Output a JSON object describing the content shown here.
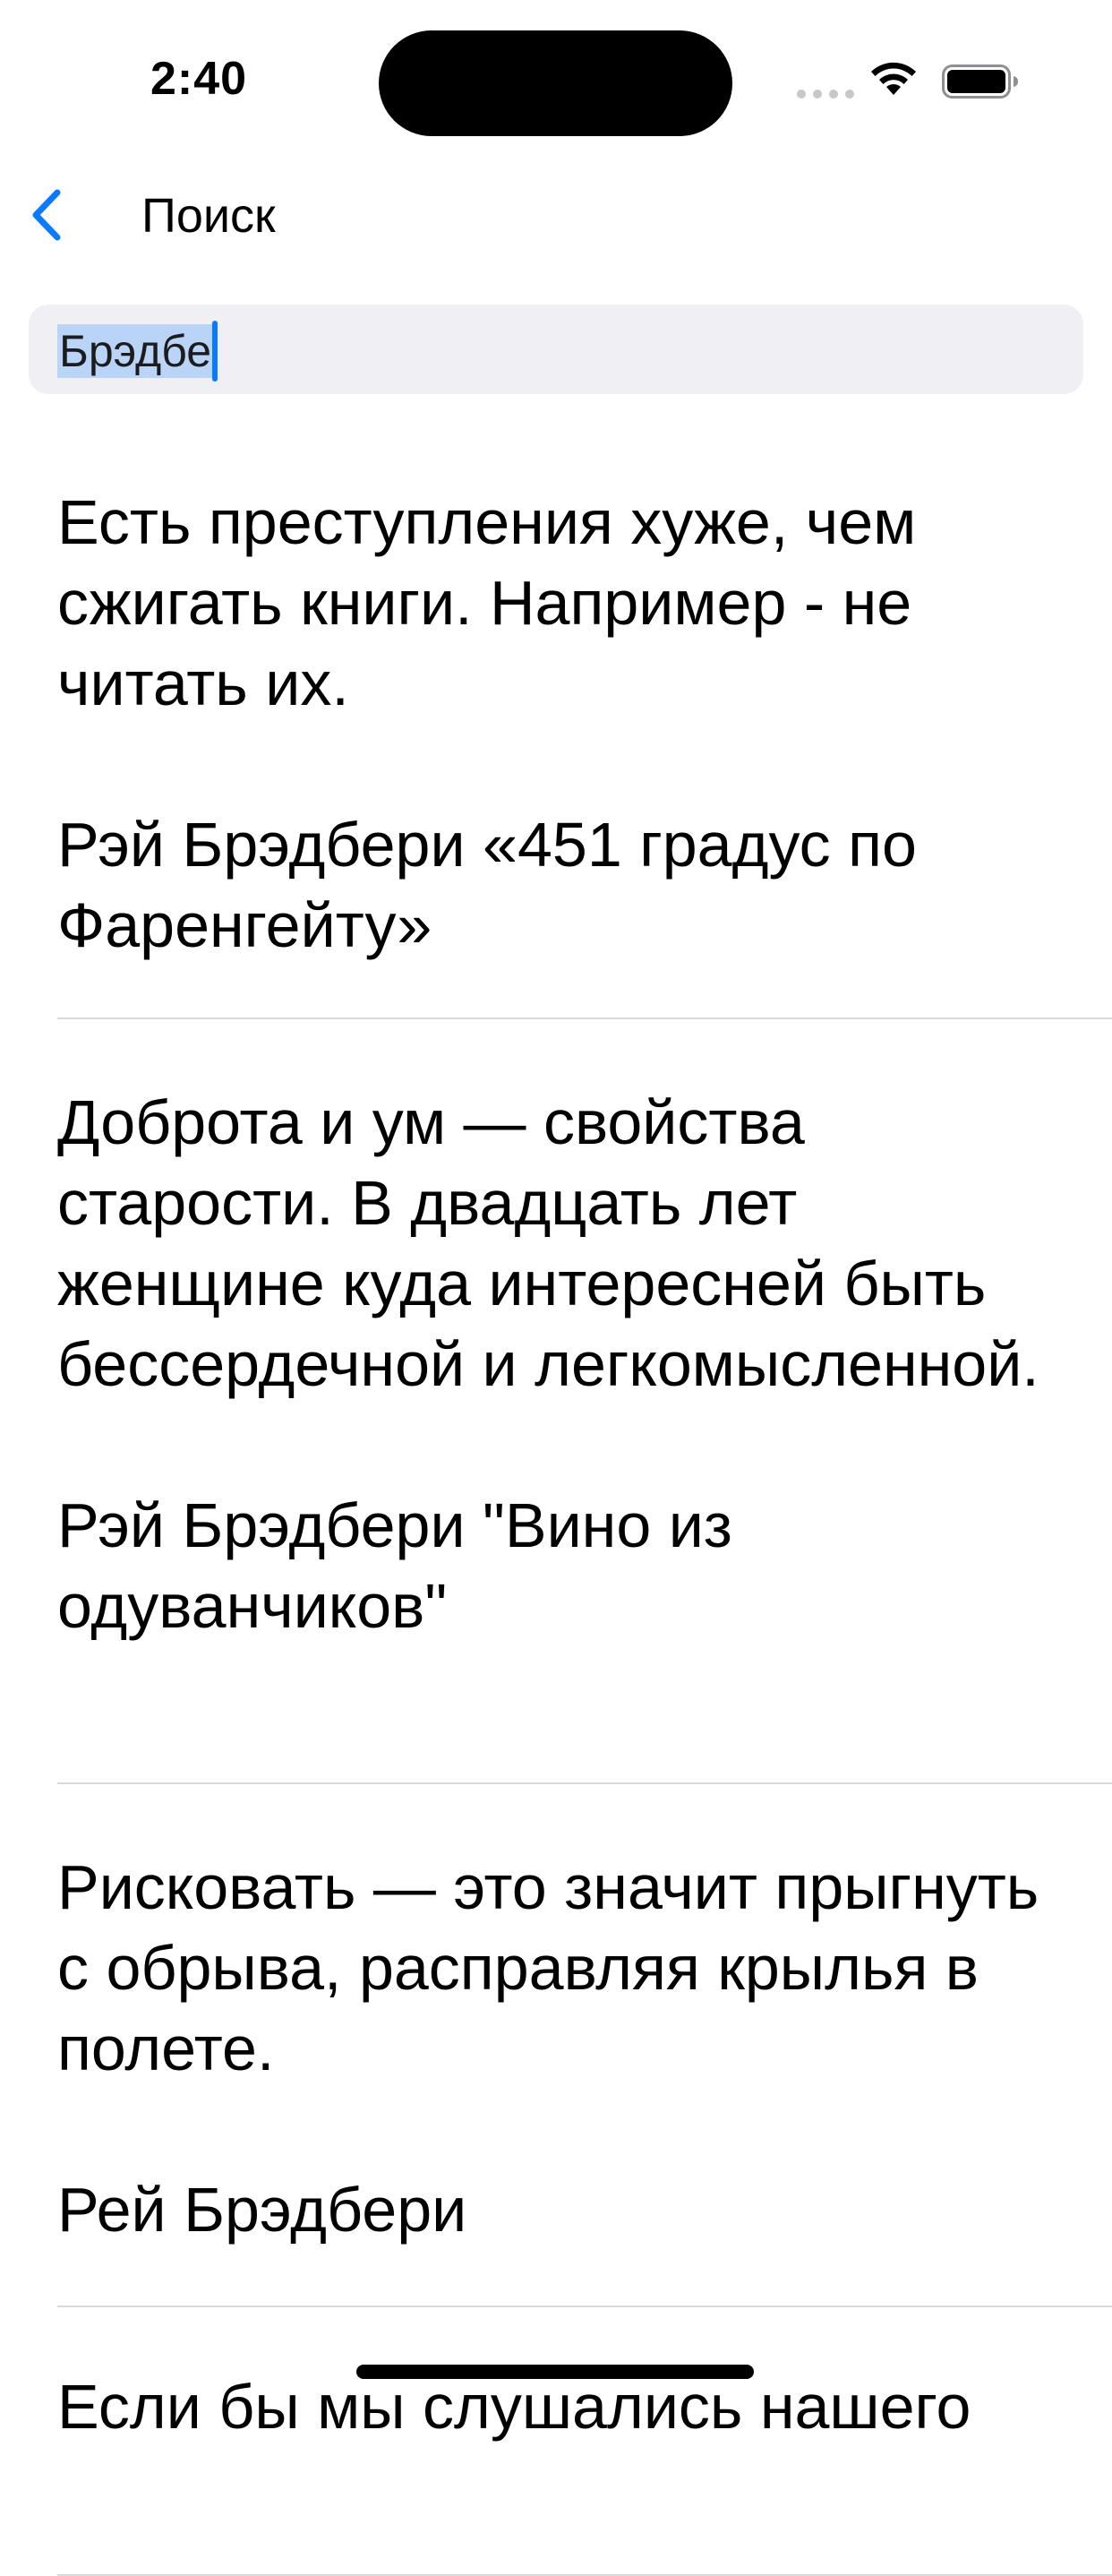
{
  "status_bar": {
    "time": "2:40"
  },
  "nav": {
    "back_icon": "chevron-left-icon",
    "title": "Поиск"
  },
  "search": {
    "value": "Брэдбе"
  },
  "quotes": [
    {
      "text": "Есть преступления хуже, чем сжигать книги. Например - не читать их.",
      "author": "Рэй Брэдбери «451 градус по Фаренгейту»"
    },
    {
      "text": "Доброта и ум — свойства старости. В двадцать лет женщине куда интересней быть бессердечной и легкомысленной.",
      "author": "Рэй Брэдбери \"Вино из одуванчиков\""
    },
    {
      "text": "Рисковать — это значит прыгнуть с обрыва, расправляя крылья в полете.",
      "author": "Рей Брэдбери"
    },
    {
      "text": "Если бы мы слушались нашего"
    }
  ],
  "colors": {
    "accent": "#0a7aff",
    "search_background": "#efeff4",
    "selection": "#b9d4f7",
    "separator": "#d9d9de"
  }
}
